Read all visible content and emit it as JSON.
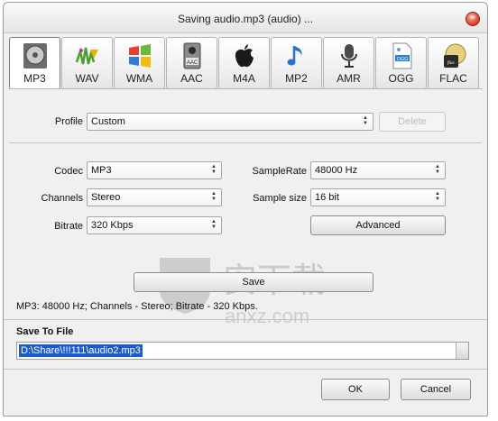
{
  "window": {
    "title": "Saving audio.mp3 (audio) ..."
  },
  "tabs": [
    {
      "label": "MP3",
      "icon": "mp3-cd-icon",
      "active": true
    },
    {
      "label": "WAV",
      "icon": "wav-icon"
    },
    {
      "label": "WMA",
      "icon": "wma-windows-icon"
    },
    {
      "label": "AAC",
      "icon": "aac-speaker-icon"
    },
    {
      "label": "M4A",
      "icon": "m4a-apple-icon"
    },
    {
      "label": "MP2",
      "icon": "mp2-note-icon"
    },
    {
      "label": "AMR",
      "icon": "amr-microphone-icon"
    },
    {
      "label": "OGG",
      "icon": "ogg-file-icon"
    },
    {
      "label": "FLAC",
      "icon": "flac-disc-icon"
    }
  ],
  "profile": {
    "label": "Profile",
    "value": "Custom",
    "side_button": "Delete"
  },
  "codec": {
    "label": "Codec",
    "value": "MP3"
  },
  "channels": {
    "label": "Channels",
    "value": "Stereo"
  },
  "bitrate": {
    "label": "Bitrate",
    "value": "320 Kbps"
  },
  "samplerate": {
    "label": "SampleRate",
    "value": "48000 Hz"
  },
  "samplesize": {
    "label": "Sample size",
    "value": "16 bit"
  },
  "buttons": {
    "advanced": "Advanced",
    "save": "Save",
    "ok": "OK",
    "cancel": "Cancel"
  },
  "info_text": "MP3: 48000  Hz; Channels - Stereo; Bitrate - 320 Kbps.",
  "save_to_file": {
    "header": "Save To File",
    "path": "D:\\Share\\!!!111\\audio2.mp3"
  },
  "watermark": {
    "text": "安下载",
    "sub": "anxz.com"
  },
  "colors": {
    "selection": "#1b5cc8",
    "close": "#e8503a"
  }
}
